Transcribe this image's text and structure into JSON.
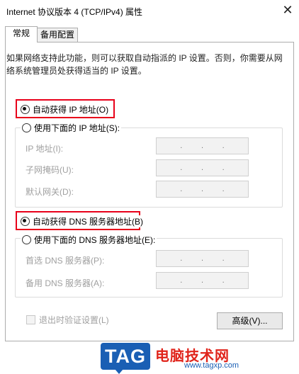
{
  "window": {
    "title": "Internet 协议版本 4 (TCP/IPv4) 属性",
    "close_glyph": "✕"
  },
  "tabs": [
    {
      "label": "常规"
    },
    {
      "label": "备用配置"
    }
  ],
  "description": "如果网络支持此功能，则可以获取自动指派的 IP 设置。否则，你需要从网络系统管理员处获得适当的 IP 设置。",
  "ip": {
    "auto_label": "自动获得 IP 地址(O)",
    "auto_selected": true,
    "manual_label": "使用下面的 IP 地址(S):",
    "fields": [
      {
        "label": "IP 地址(I):"
      },
      {
        "label": "子网掩码(U):"
      },
      {
        "label": "默认网关(D):"
      }
    ]
  },
  "dns": {
    "auto_label": "自动获得 DNS 服务器地址(B)",
    "auto_selected": true,
    "manual_label": "使用下面的 DNS 服务器地址(E):",
    "fields": [
      {
        "label": "首选 DNS 服务器(P):"
      },
      {
        "label": "备用 DNS 服务器(A):"
      }
    ]
  },
  "ip_dot": ".",
  "exit_validate_label": "退出时验证设置(L)",
  "advanced_button": "高级(V)...",
  "watermark": {
    "logo": "TAG",
    "site": "电脑技术网",
    "url": "www.tagxp.com"
  },
  "colors": {
    "highlight": "#e8001a",
    "disabled_text": "#a0a0a0",
    "brand_blue": "#1a5fb4"
  }
}
